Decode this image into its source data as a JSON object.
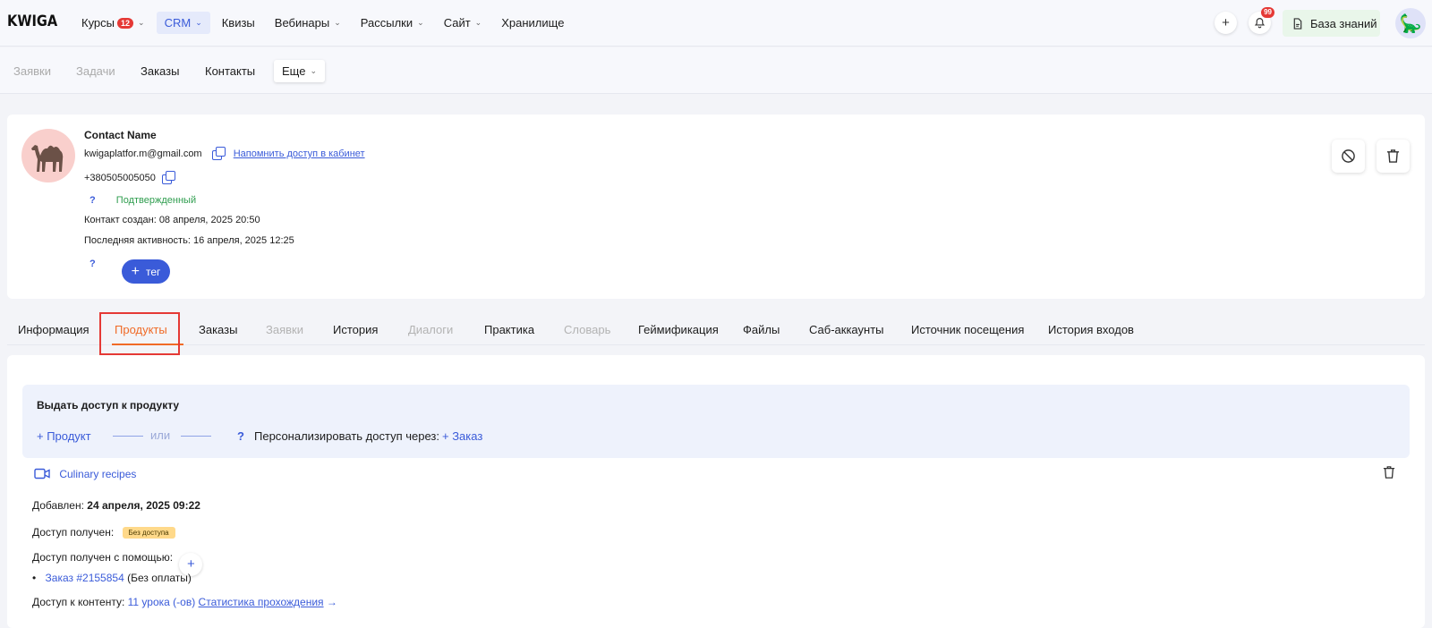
{
  "brand": "KWIGA",
  "topnav": {
    "items": [
      {
        "label": "Курсы",
        "badge": "12",
        "dropdown": true,
        "active": false
      },
      {
        "label": "CRM",
        "dropdown": true,
        "active": true
      },
      {
        "label": "Квизы",
        "dropdown": false,
        "active": false
      },
      {
        "label": "Вебинары",
        "dropdown": true,
        "active": false
      },
      {
        "label": "Рассылки",
        "dropdown": true,
        "active": false
      },
      {
        "label": "Сайт",
        "dropdown": true,
        "active": false
      },
      {
        "label": "Хранилище",
        "dropdown": false,
        "active": false
      }
    ],
    "add_icon": "plus-icon",
    "notifications_count": "99",
    "knowledge_base_label": "База знаний"
  },
  "subnav": {
    "requests": "Заявки",
    "tasks": "Задачи",
    "orders": "Заказы",
    "contacts": "Контакты",
    "more": "Еще"
  },
  "contact": {
    "name": "Contact Name",
    "email": "kwigaplatfor.m@gmail.com",
    "remind_link": "Напомнить доступ в кабинет",
    "phone": "+380505005050",
    "status_q": "?",
    "status": "Подтвержденный",
    "created_label": "Контакт создан:",
    "created_value": "08 апреля, 2025 20:50",
    "activity_label": "Последняя активность:",
    "activity_value": "16 апреля, 2025 12:25",
    "tag_q": "?",
    "tag_button": "тег"
  },
  "tabs": [
    {
      "label": "Информация",
      "state": "normal"
    },
    {
      "label": "Продукты",
      "state": "active"
    },
    {
      "label": "Заказы",
      "state": "normal"
    },
    {
      "label": "Заявки",
      "state": "dim"
    },
    {
      "label": "История",
      "state": "normal"
    },
    {
      "label": "Диалоги",
      "state": "dim"
    },
    {
      "label": "Практика",
      "state": "normal"
    },
    {
      "label": "Словарь",
      "state": "dim"
    },
    {
      "label": "Геймификация",
      "state": "normal"
    },
    {
      "label": "Файлы",
      "state": "normal"
    },
    {
      "label": "Саб-аккаунты",
      "state": "normal"
    },
    {
      "label": "Источник посещения",
      "state": "normal"
    },
    {
      "label": "История входов",
      "state": "normal"
    }
  ],
  "grant": {
    "title": "Выдать доступ к продукту",
    "add_product": "+ Продукт",
    "or": "или",
    "q": "?",
    "personalize": "Персонализировать доступ через:",
    "add_order": "+ Заказ"
  },
  "product": {
    "name": "Culinary recipes",
    "added_label": "Добавлен:",
    "added_value": "24 апреля, 2025 09:22",
    "access_label": "Доступ получен:",
    "access_badge": "Без доступа",
    "via_label": "Доступ получен с помощью:",
    "order_link": "Заказ #2155854",
    "order_note": "(Без оплаты)",
    "content_label": "Доступ к контенту:",
    "lessons_link": "11 урока (-ов)",
    "stats_link": "Статистика прохождения",
    "arrow": "→"
  },
  "colors": {
    "accent": "#3a5bd9",
    "active_tab": "#f06a26",
    "badge_red": "#e53935",
    "success": "#2e9d4e",
    "warning_badge": "#ffd98a"
  }
}
